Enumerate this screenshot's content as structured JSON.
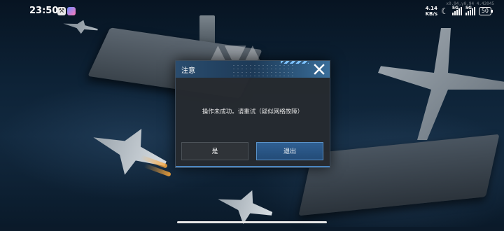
{
  "status_bar": {
    "time": "23:50",
    "net_speed_value": "4.14",
    "net_speed_unit": "KB/s",
    "sig1_label": "5G",
    "sig2_label": "5G",
    "battery": "50",
    "debug_coords": "x0.94,y0.94 4.42045"
  },
  "background": {
    "icons": [
      "carrier-ship",
      "fighter-jet",
      "bomber-plane",
      "game-logo"
    ]
  },
  "dialog": {
    "title": "注意",
    "message": "操作未成功。请重试（疑似网络故障）",
    "yes_label": "是",
    "exit_label": "退出",
    "accent_color": "#4a85bf"
  }
}
